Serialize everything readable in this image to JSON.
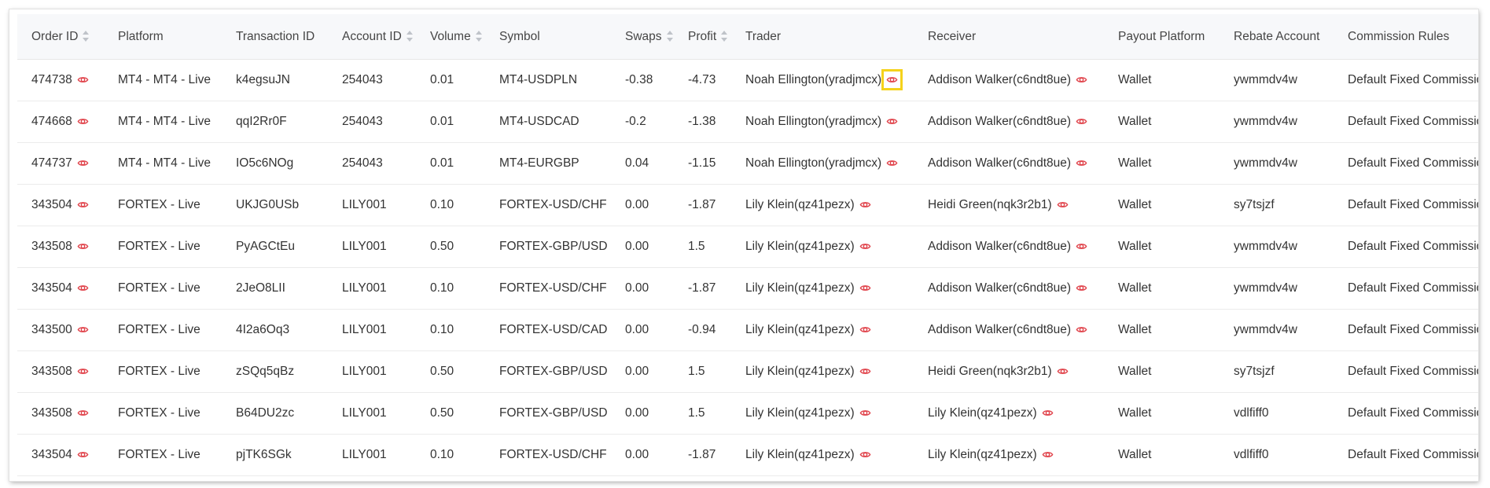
{
  "columns": [
    {
      "label": "Order ID",
      "sortable": true
    },
    {
      "label": "Platform",
      "sortable": false
    },
    {
      "label": "Transaction ID",
      "sortable": false
    },
    {
      "label": "Account ID",
      "sortable": true
    },
    {
      "label": "Volume",
      "sortable": true
    },
    {
      "label": "Symbol",
      "sortable": false
    },
    {
      "label": "Swaps",
      "sortable": true
    },
    {
      "label": "Profit",
      "sortable": true
    },
    {
      "label": "Trader",
      "sortable": false
    },
    {
      "label": "Receiver",
      "sortable": false
    },
    {
      "label": "Payout Platform",
      "sortable": false
    },
    {
      "label": "Rebate Account",
      "sortable": false
    },
    {
      "label": "Commission Rules",
      "sortable": false
    }
  ],
  "rows": [
    {
      "order_id": "474738",
      "platform": "MT4 - MT4 - Live",
      "transaction_id": "k4egsuJN",
      "account_id": "254043",
      "volume": "0.01",
      "symbol": "MT4-USDPLN",
      "swaps": "-0.38",
      "profit": "-4.73",
      "trader": "Noah Ellington(yradjmcx)",
      "receiver": "Addison Walker(c6ndt8ue)",
      "payout_platform": "Wallet",
      "rebate_account": "ywmmdv4w",
      "commission_rules": "Default Fixed Commission"
    },
    {
      "order_id": "474668",
      "platform": "MT4 - MT4 - Live",
      "transaction_id": "qqI2Rr0F",
      "account_id": "254043",
      "volume": "0.01",
      "symbol": "MT4-USDCAD",
      "swaps": "-0.2",
      "profit": "-1.38",
      "trader": "Noah Ellington(yradjmcx)",
      "receiver": "Addison Walker(c6ndt8ue)",
      "payout_platform": "Wallet",
      "rebate_account": "ywmmdv4w",
      "commission_rules": "Default Fixed Commission"
    },
    {
      "order_id": "474737",
      "platform": "MT4 - MT4 - Live",
      "transaction_id": "IO5c6NOg",
      "account_id": "254043",
      "volume": "0.01",
      "symbol": "MT4-EURGBP",
      "swaps": "0.04",
      "profit": "-1.15",
      "trader": "Noah Ellington(yradjmcx)",
      "receiver": "Addison Walker(c6ndt8ue)",
      "payout_platform": "Wallet",
      "rebate_account": "ywmmdv4w",
      "commission_rules": "Default Fixed Commission"
    },
    {
      "order_id": "343504",
      "platform": "FORTEX - Live",
      "transaction_id": "UKJG0USb",
      "account_id": "LILY001",
      "volume": "0.10",
      "symbol": "FORTEX-USD/CHF",
      "swaps": "0.00",
      "profit": "-1.87",
      "trader": "Lily Klein(qz41pezx)",
      "receiver": "Heidi Green(nqk3r2b1)",
      "payout_platform": "Wallet",
      "rebate_account": "sy7tsjzf",
      "commission_rules": "Default Fixed Commission"
    },
    {
      "order_id": "343508",
      "platform": "FORTEX - Live",
      "transaction_id": "PyAGCtEu",
      "account_id": "LILY001",
      "volume": "0.50",
      "symbol": "FORTEX-GBP/USD",
      "swaps": "0.00",
      "profit": "1.5",
      "trader": "Lily Klein(qz41pezx)",
      "receiver": "Addison Walker(c6ndt8ue)",
      "payout_platform": "Wallet",
      "rebate_account": "ywmmdv4w",
      "commission_rules": "Default Fixed Commission"
    },
    {
      "order_id": "343504",
      "platform": "FORTEX - Live",
      "transaction_id": "2JeO8LII",
      "account_id": "LILY001",
      "volume": "0.10",
      "symbol": "FORTEX-USD/CHF",
      "swaps": "0.00",
      "profit": "-1.87",
      "trader": "Lily Klein(qz41pezx)",
      "receiver": "Addison Walker(c6ndt8ue)",
      "payout_platform": "Wallet",
      "rebate_account": "ywmmdv4w",
      "commission_rules": "Default Fixed Commission"
    },
    {
      "order_id": "343500",
      "platform": "FORTEX - Live",
      "transaction_id": "4I2a6Oq3",
      "account_id": "LILY001",
      "volume": "0.10",
      "symbol": "FORTEX-USD/CAD",
      "swaps": "0.00",
      "profit": "-0.94",
      "trader": "Lily Klein(qz41pezx)",
      "receiver": "Addison Walker(c6ndt8ue)",
      "payout_platform": "Wallet",
      "rebate_account": "ywmmdv4w",
      "commission_rules": "Default Fixed Commission"
    },
    {
      "order_id": "343508",
      "platform": "FORTEX - Live",
      "transaction_id": "zSQq5qBz",
      "account_id": "LILY001",
      "volume": "0.50",
      "symbol": "FORTEX-GBP/USD",
      "swaps": "0.00",
      "profit": "1.5",
      "trader": "Lily Klein(qz41pezx)",
      "receiver": "Heidi Green(nqk3r2b1)",
      "payout_platform": "Wallet",
      "rebate_account": "sy7tsjzf",
      "commission_rules": "Default Fixed Commission"
    },
    {
      "order_id": "343508",
      "platform": "FORTEX - Live",
      "transaction_id": "B64DU2zc",
      "account_id": "LILY001",
      "volume": "0.50",
      "symbol": "FORTEX-GBP/USD",
      "swaps": "0.00",
      "profit": "1.5",
      "trader": "Lily Klein(qz41pezx)",
      "receiver": "Lily Klein(qz41pezx)",
      "payout_platform": "Wallet",
      "rebate_account": "vdlfiff0",
      "commission_rules": "Default Fixed Commission"
    },
    {
      "order_id": "343504",
      "platform": "FORTEX - Live",
      "transaction_id": "pjTK6SGk",
      "account_id": "LILY001",
      "volume": "0.10",
      "symbol": "FORTEX-USD/CHF",
      "swaps": "0.00",
      "profit": "-1.87",
      "trader": "Lily Klein(qz41pezx)",
      "receiver": "Lily Klein(qz41pezx)",
      "payout_platform": "Wallet",
      "rebate_account": "vdlfiff0",
      "commission_rules": "Default Fixed Commission"
    }
  ],
  "colors": {
    "eye_icon": "#e0424a",
    "header_bg": "#f7f8fa",
    "highlight": "#f5d21b"
  },
  "icons": {
    "view": "eye-icon",
    "sort": "sort-caret-icon"
  }
}
